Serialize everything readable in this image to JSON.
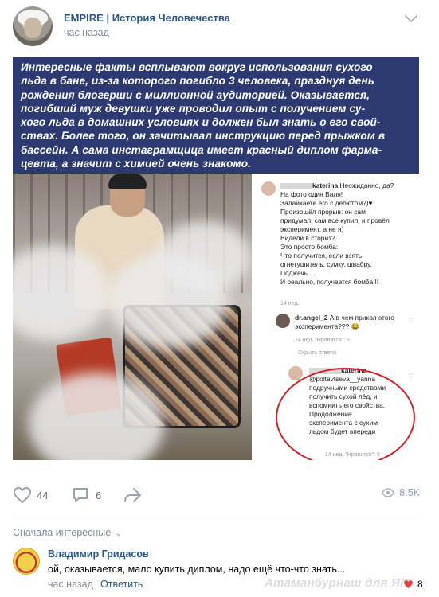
{
  "post": {
    "author": "EMPIRE | История Человечества",
    "time": "час назад"
  },
  "caption": {
    "lines": [
      "Интересные факты всплывают вокруг использования сухого",
      "льда в бане, из-за которого погибло 3 человека, празднуя день",
      "рождения блогерши с миллионной аудиторией. Оказывается,",
      "погибший муж девушки уже проводил опыт с получением су-",
      "хого льда в домашних условиях и должен был знать о его свой-",
      "ствах. Более того, он зачитывал инструкцию перед прыжком в",
      "бассейн. А сама инстаграмщица имеет красный диплом фарма-",
      "цевта, а значит с химией очень знакомо."
    ]
  },
  "instagram": {
    "comment1": {
      "user": "katerina",
      "lines": [
        "Неожиданно, да?",
        "На фото один Валя!",
        "Залайкаете его с дебютом?)♥",
        "Произошёл прорыв: он сам",
        "придумал, сам все купил, и провёл",
        "эксперимент, а не я)",
        "Видели в сториз?",
        "Это просто бомба:",
        "Что получится, если взять",
        "огнетушитель, сумку, швабру.",
        "Поджечь....",
        "И реально, получается бомба!!!"
      ],
      "meta": "14 нед."
    },
    "comment2": {
      "user": "dr.angel_2",
      "lines": [
        "А в чем прикол этого",
        "эксперимента??? 😂"
      ],
      "meta": "14 нед.   \"Нравится\": 5",
      "hide": "Скрыть ответы"
    },
    "comment3": {
      "user": "katerina",
      "lines": [
        "@poltavtseva__yanna",
        "подручными средствами",
        "получить сухой лёд, и",
        "вспомнить его свойства.",
        "Продолжение",
        "эксперимента с сухим",
        "льдом будет впереди"
      ],
      "meta": "14 нед.   \"Нравится\": 6"
    }
  },
  "actions": {
    "likes": "44",
    "comments": "6",
    "views": "8.5K"
  },
  "comments_sort": "Сначала интересные",
  "comment": {
    "author": "Владимир Гридасов",
    "text": "ой, оказывается, мало купить диплом, надо ещё что-что знать...",
    "time": "час назад",
    "reply": "Ответить",
    "likes": "8"
  },
  "watermark": "Атаманбурнаш для ЯП",
  "colors": {
    "link": "#2a5885",
    "muted": "#818c99",
    "caption_bg": "#2d3a72",
    "ring": "#d4202a"
  }
}
